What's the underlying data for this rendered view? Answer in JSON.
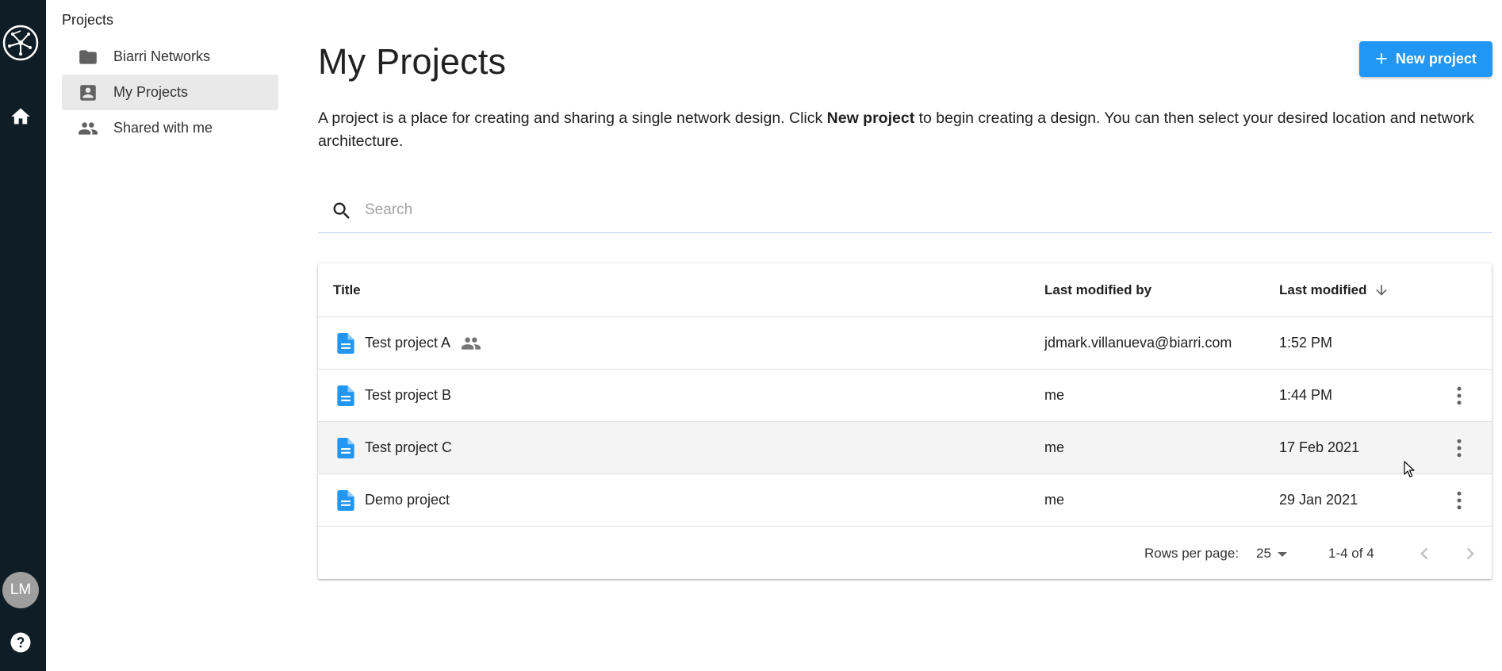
{
  "rail": {
    "avatar_initials": "LM",
    "logo_icon": "network-logo-icon",
    "home_icon": "home-icon",
    "help_icon": "help-icon",
    "background": "#0f1e26"
  },
  "sidebar": {
    "heading": "Projects",
    "items": [
      {
        "label": "Biarri Networks",
        "icon": "folder-icon",
        "active": false
      },
      {
        "label": "My Projects",
        "icon": "account-box-icon",
        "active": true
      },
      {
        "label": "Shared with me",
        "icon": "people-icon",
        "active": false
      }
    ]
  },
  "main": {
    "title": "My Projects",
    "new_project_label": "New project",
    "intro_before": "A project is a place for creating and sharing a single network design. Click ",
    "intro_bold": "New project",
    "intro_after": " to begin creating a design. You can then select your desired location and network architecture.",
    "search": {
      "placeholder": "Search",
      "value": ""
    }
  },
  "table": {
    "columns": {
      "title": "Title",
      "modified_by": "Last modified by",
      "modified": "Last modified"
    },
    "sort_icon": "arrow-down-icon",
    "rows": [
      {
        "title": "Test project A",
        "shared": true,
        "modified_by": "jdmark.villanueva@biarri.com",
        "modified": "1:52 PM",
        "has_menu": false
      },
      {
        "title": "Test project B",
        "shared": false,
        "modified_by": "me",
        "modified": "1:44 PM",
        "has_menu": true
      },
      {
        "title": "Test project C",
        "shared": false,
        "modified_by": "me",
        "modified": "17 Feb 2021",
        "has_menu": true
      },
      {
        "title": "Demo project",
        "shared": false,
        "modified_by": "me",
        "modified": "29 Jan 2021",
        "has_menu": true
      }
    ],
    "footer": {
      "rows_per_page_label": "Rows per page:",
      "rows_per_page_value": "25",
      "range": "1-4 of 4"
    }
  },
  "colors": {
    "accent": "#2196f3",
    "doc_icon": "#2196f3",
    "hover_row": "#f4f4f4",
    "active_sidebar": "#e9e9e9"
  }
}
